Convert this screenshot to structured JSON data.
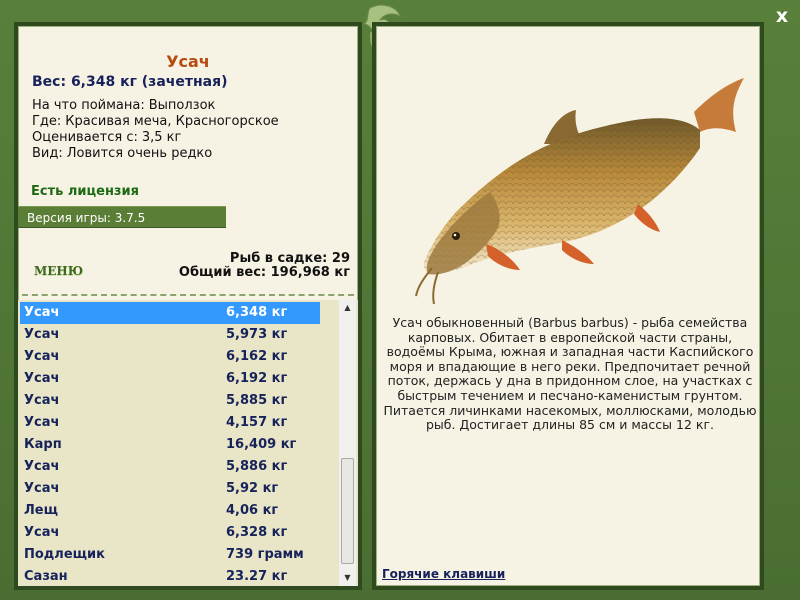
{
  "fish": {
    "name": "Усач",
    "weight_line": "Вес: 6,348 кг (зачетная)",
    "caught_on_label": "На что поймана:",
    "caught_on_value": "Выползок",
    "location_label": "Где:",
    "location_value": "Красивая меча, Красногорское",
    "rated_from_label": "Оценивается с:",
    "rated_from_value": "3,5 кг",
    "kind_label": "Вид:",
    "kind_value": "Ловится очень редко",
    "description": "Усач обыкновенный (Barbus barbus) - рыба семейства карповых. Обитает в европейской части страны, водоёмы Крыма, южная и западная части Каспийского моря и впадающие в него реки. Предпочитает речной поток, держась у дна в придонном слое, на участках с быстрым течением и песчано-каменистым грунтом. Питается личинками насекомых, моллюсками, молодью рыб. Достигает длины 85 см и массы 12 кг."
  },
  "license_text": "Есть лицензия",
  "version_text": "Версия игры: 3.7.5",
  "menu_label": "МЕНЮ",
  "stats": {
    "fish_in_net": "Рыб в садке: 29",
    "total_weight": "Общий вес: 196,968 кг"
  },
  "catch_list": [
    {
      "name": "Усач",
      "weight": "6,348 кг",
      "selected": true
    },
    {
      "name": "Усач",
      "weight": "5,973 кг"
    },
    {
      "name": "Усач",
      "weight": "6,162 кг"
    },
    {
      "name": "Усач",
      "weight": "6,192 кг"
    },
    {
      "name": "Усач",
      "weight": "5,885 кг"
    },
    {
      "name": "Усач",
      "weight": "4,157 кг"
    },
    {
      "name": "Карп",
      "weight": "16,409 кг"
    },
    {
      "name": "Усач",
      "weight": "5,886 кг"
    },
    {
      "name": "Усач",
      "weight": "5,92 кг"
    },
    {
      "name": "Лещ",
      "weight": "4,06 кг"
    },
    {
      "name": "Усач",
      "weight": "6,328 кг"
    },
    {
      "name": "Подлещик",
      "weight": "739 грамм"
    },
    {
      "name": "Сазан",
      "weight": "23.27 кг"
    }
  ],
  "hotkeys_label": "Горячие клавиши",
  "close_label": "x",
  "icons": {
    "close": "close-icon",
    "emblem": "leaf-emblem-icon",
    "scroll_up": "scroll-up-arrow-icon",
    "scroll_down": "scroll-down-arrow-icon"
  },
  "colors": {
    "frame": "#4e7434",
    "panel": "#f7f3e4",
    "selection": "#3399ff",
    "title": "#b64a10",
    "license": "#1c6a14",
    "list_text": "#17225b"
  }
}
